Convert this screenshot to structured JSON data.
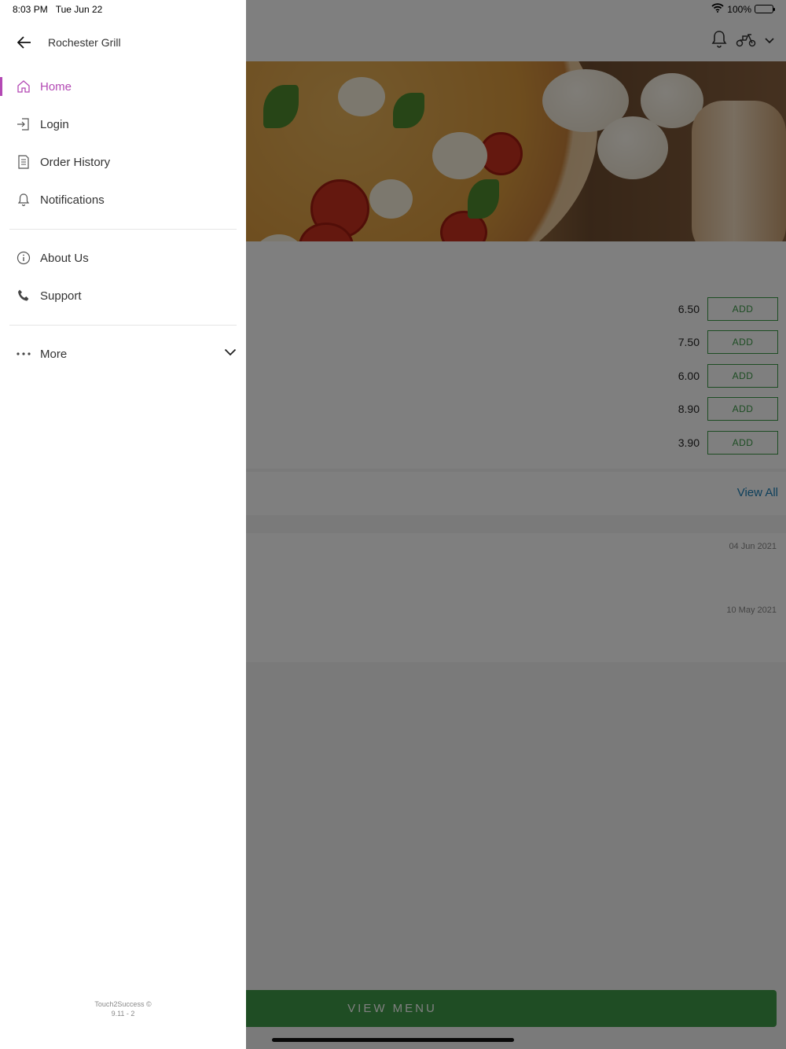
{
  "status_bar": {
    "time": "8:03 PM",
    "date": "Tue Jun 22",
    "battery": "100%"
  },
  "drawer": {
    "store_name": "Rochester Grill",
    "primary_items": [
      {
        "label": "Home",
        "icon": "home-icon",
        "active": true
      },
      {
        "label": "Login",
        "icon": "login-icon",
        "active": false
      },
      {
        "label": "Order History",
        "icon": "receipt-icon",
        "active": false
      },
      {
        "label": "Notifications",
        "icon": "bell-icon",
        "active": false
      }
    ],
    "secondary_items": [
      {
        "label": "About Us",
        "icon": "info-icon"
      },
      {
        "label": "Support",
        "icon": "phone-icon"
      }
    ],
    "more": {
      "label": "More",
      "icon": "more-dots-icon"
    },
    "footer": {
      "brand": "Touch2Success ©",
      "version": "9.11 - 2"
    }
  },
  "background": {
    "items": [
      {
        "price": "6.50",
        "button": "ADD"
      },
      {
        "price": "7.50",
        "button": "ADD"
      },
      {
        "price": "6.00",
        "button": "ADD"
      },
      {
        "price": "8.90",
        "button": "ADD"
      },
      {
        "price": "3.90",
        "button": "ADD"
      }
    ],
    "view_all": "View All",
    "review_dates": [
      "04 Jun 2021",
      "10 May 2021"
    ],
    "view_menu": "VIEW MENU"
  },
  "colors": {
    "accent": "#b349b4",
    "green": "#3f9a48",
    "link": "#1a7fb6"
  }
}
